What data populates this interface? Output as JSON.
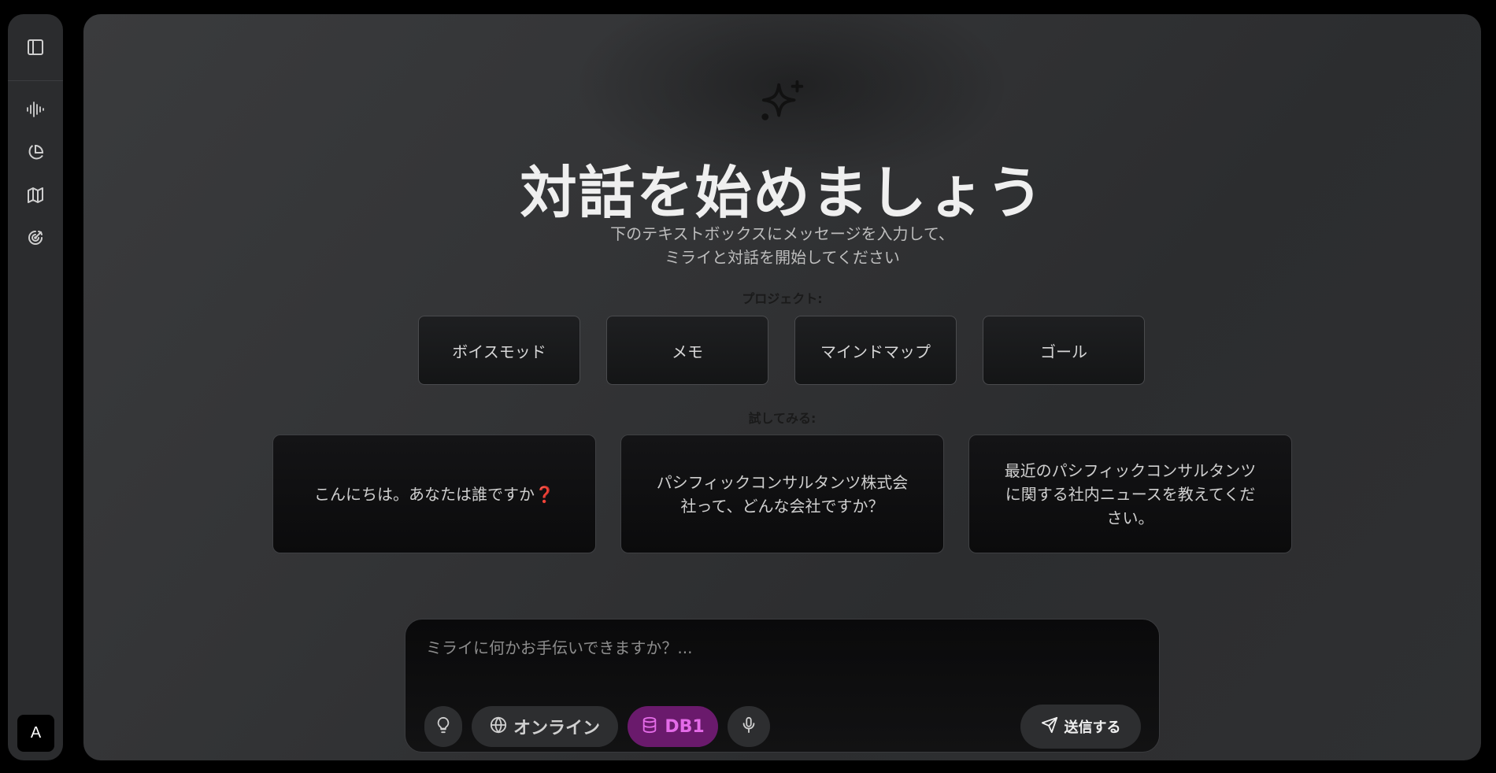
{
  "sidebar": {
    "avatar_initial": "A",
    "icons": [
      "panel-toggle-icon",
      "voice-wave-icon",
      "pie-chart-icon",
      "map-icon",
      "goal-target-icon"
    ]
  },
  "main": {
    "title": "対話を始めましょう",
    "subtitle_line1": "下のテキストボックスにメッセージを入力して、",
    "subtitle_line2": "ミライと対話を開始してください",
    "projects_label": "プロジェクト:",
    "projects": [
      "ボイスモッド",
      "メモ",
      "マインドマップ",
      "ゴール"
    ],
    "try_label": "試してみる:",
    "suggestions": [
      {
        "text": "こんにちは。あなたは誰ですか",
        "emoji": "❓"
      },
      {
        "text": "パシフィックコンサルタンツ株式会社って、どんな会社ですか？",
        "emoji": ""
      },
      {
        "text": "最近のパシフィックコンサルタンツに関する社内ニュースを教えてください。",
        "emoji": ""
      }
    ]
  },
  "composer": {
    "placeholder": "ミライに何かお手伝いできますか？...",
    "online_label": "オンライン",
    "db_label": "DB1",
    "send_label": "送信する"
  },
  "colors": {
    "db_pill_bg": "#6a1a6c",
    "db_pill_text": "#e46be8",
    "question_mark": "#e0435e"
  }
}
